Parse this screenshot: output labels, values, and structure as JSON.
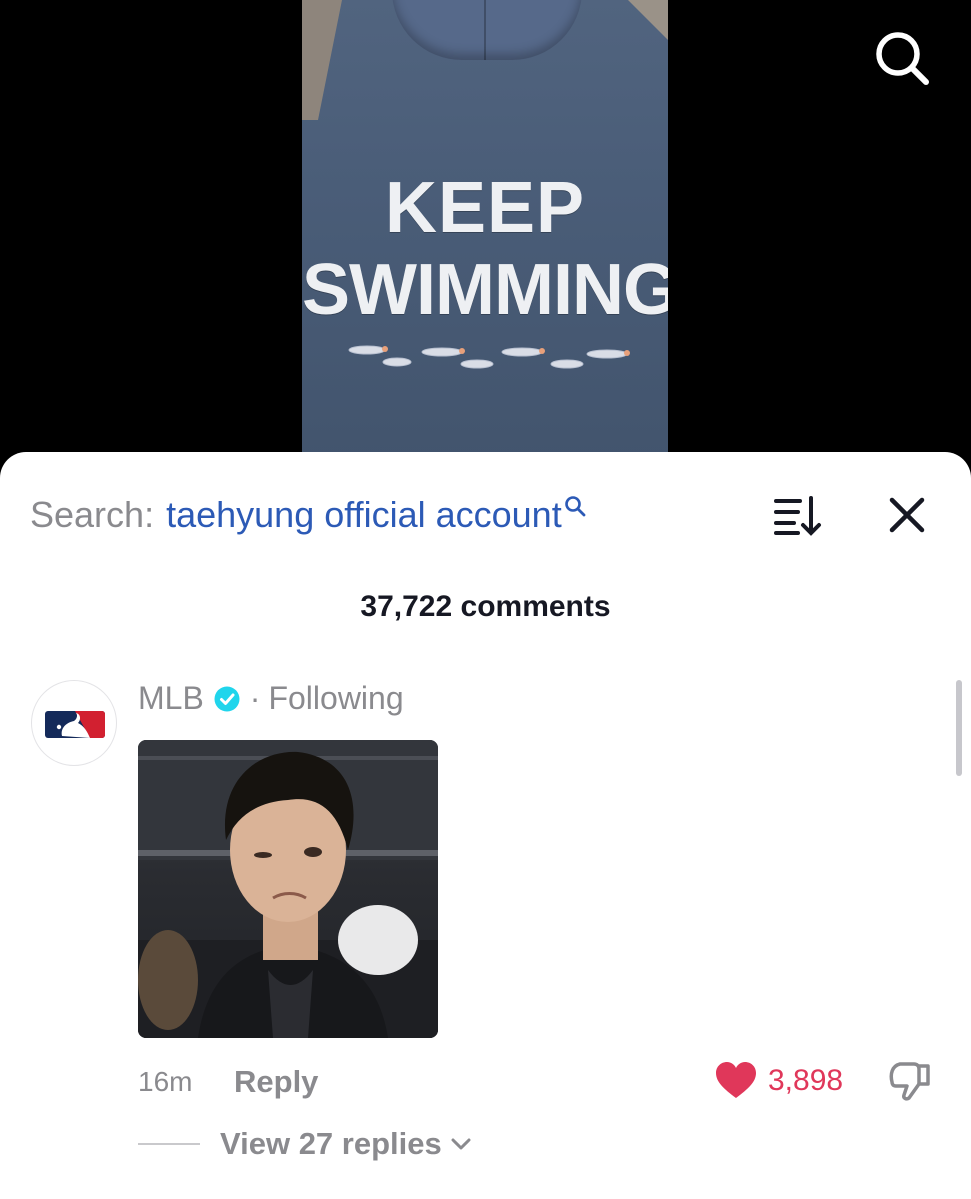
{
  "video": {
    "shirt_print_line1": "KEEP",
    "shirt_print_line2": "SWIMMING",
    "search_icon": "search-icon"
  },
  "comments_panel": {
    "search_prefix": "Search:",
    "search_term": "taehyung official account",
    "search_term_icon": "search-icon",
    "sort_icon": "sort-descending-icon",
    "close_icon": "close-icon",
    "comment_count": "37,722 comments"
  },
  "comment": {
    "author": "MLB",
    "verified_icon": "verified-badge-icon",
    "separator": "·",
    "follow_status": "Following",
    "time": "16m",
    "reply_label": "Reply",
    "like_icon": "heart-icon",
    "like_count": "3,898",
    "dislike_icon": "thumbs-down-icon",
    "view_replies": "View 27 replies",
    "expand_icon": "chevron-down-icon"
  },
  "colors": {
    "search_term": "#2c5ab6",
    "like": "#e0375a",
    "verified": "#20d5ec",
    "muted_text": "#8a8a8e"
  }
}
